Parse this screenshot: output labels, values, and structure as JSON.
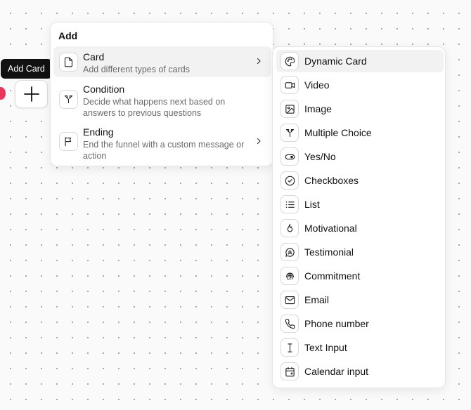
{
  "tooltip": {
    "label": "Add Card"
  },
  "add_button": {
    "icon": "plus-icon"
  },
  "menu": {
    "title": "Add",
    "items": [
      {
        "title": "Card",
        "description": "Add different types of cards",
        "icon": "file-icon",
        "has_submenu": true
      },
      {
        "title": "Condition",
        "description": "Decide what happens next based on answers to previous questions",
        "icon": "split-icon",
        "has_submenu": false
      },
      {
        "title": "Ending",
        "description": "End the funnel with a custom message or action",
        "icon": "flag-icon",
        "has_submenu": true
      }
    ]
  },
  "submenu": {
    "items": [
      {
        "label": "Dynamic Card",
        "icon": "palette-icon"
      },
      {
        "label": "Video",
        "icon": "video-icon"
      },
      {
        "label": "Image",
        "icon": "image-icon"
      },
      {
        "label": "Multiple Choice",
        "icon": "split-icon"
      },
      {
        "label": "Yes/No",
        "icon": "toggle-icon"
      },
      {
        "label": "Checkboxes",
        "icon": "check-circle-icon"
      },
      {
        "label": "List",
        "icon": "list-icon"
      },
      {
        "label": "Motivational",
        "icon": "flame-icon"
      },
      {
        "label": "Testimonial",
        "icon": "quote-bubble-icon"
      },
      {
        "label": "Commitment",
        "icon": "fingerprint-icon"
      },
      {
        "label": "Email",
        "icon": "mail-icon"
      },
      {
        "label": "Phone number",
        "icon": "phone-icon"
      },
      {
        "label": "Text Input",
        "icon": "text-cursor-icon"
      },
      {
        "label": "Calendar input",
        "icon": "calendar-icon"
      }
    ]
  },
  "colors": {
    "accent_dot": "#e8355b",
    "tooltip_bg": "#111111",
    "hover_bg": "#f2f2f2"
  }
}
